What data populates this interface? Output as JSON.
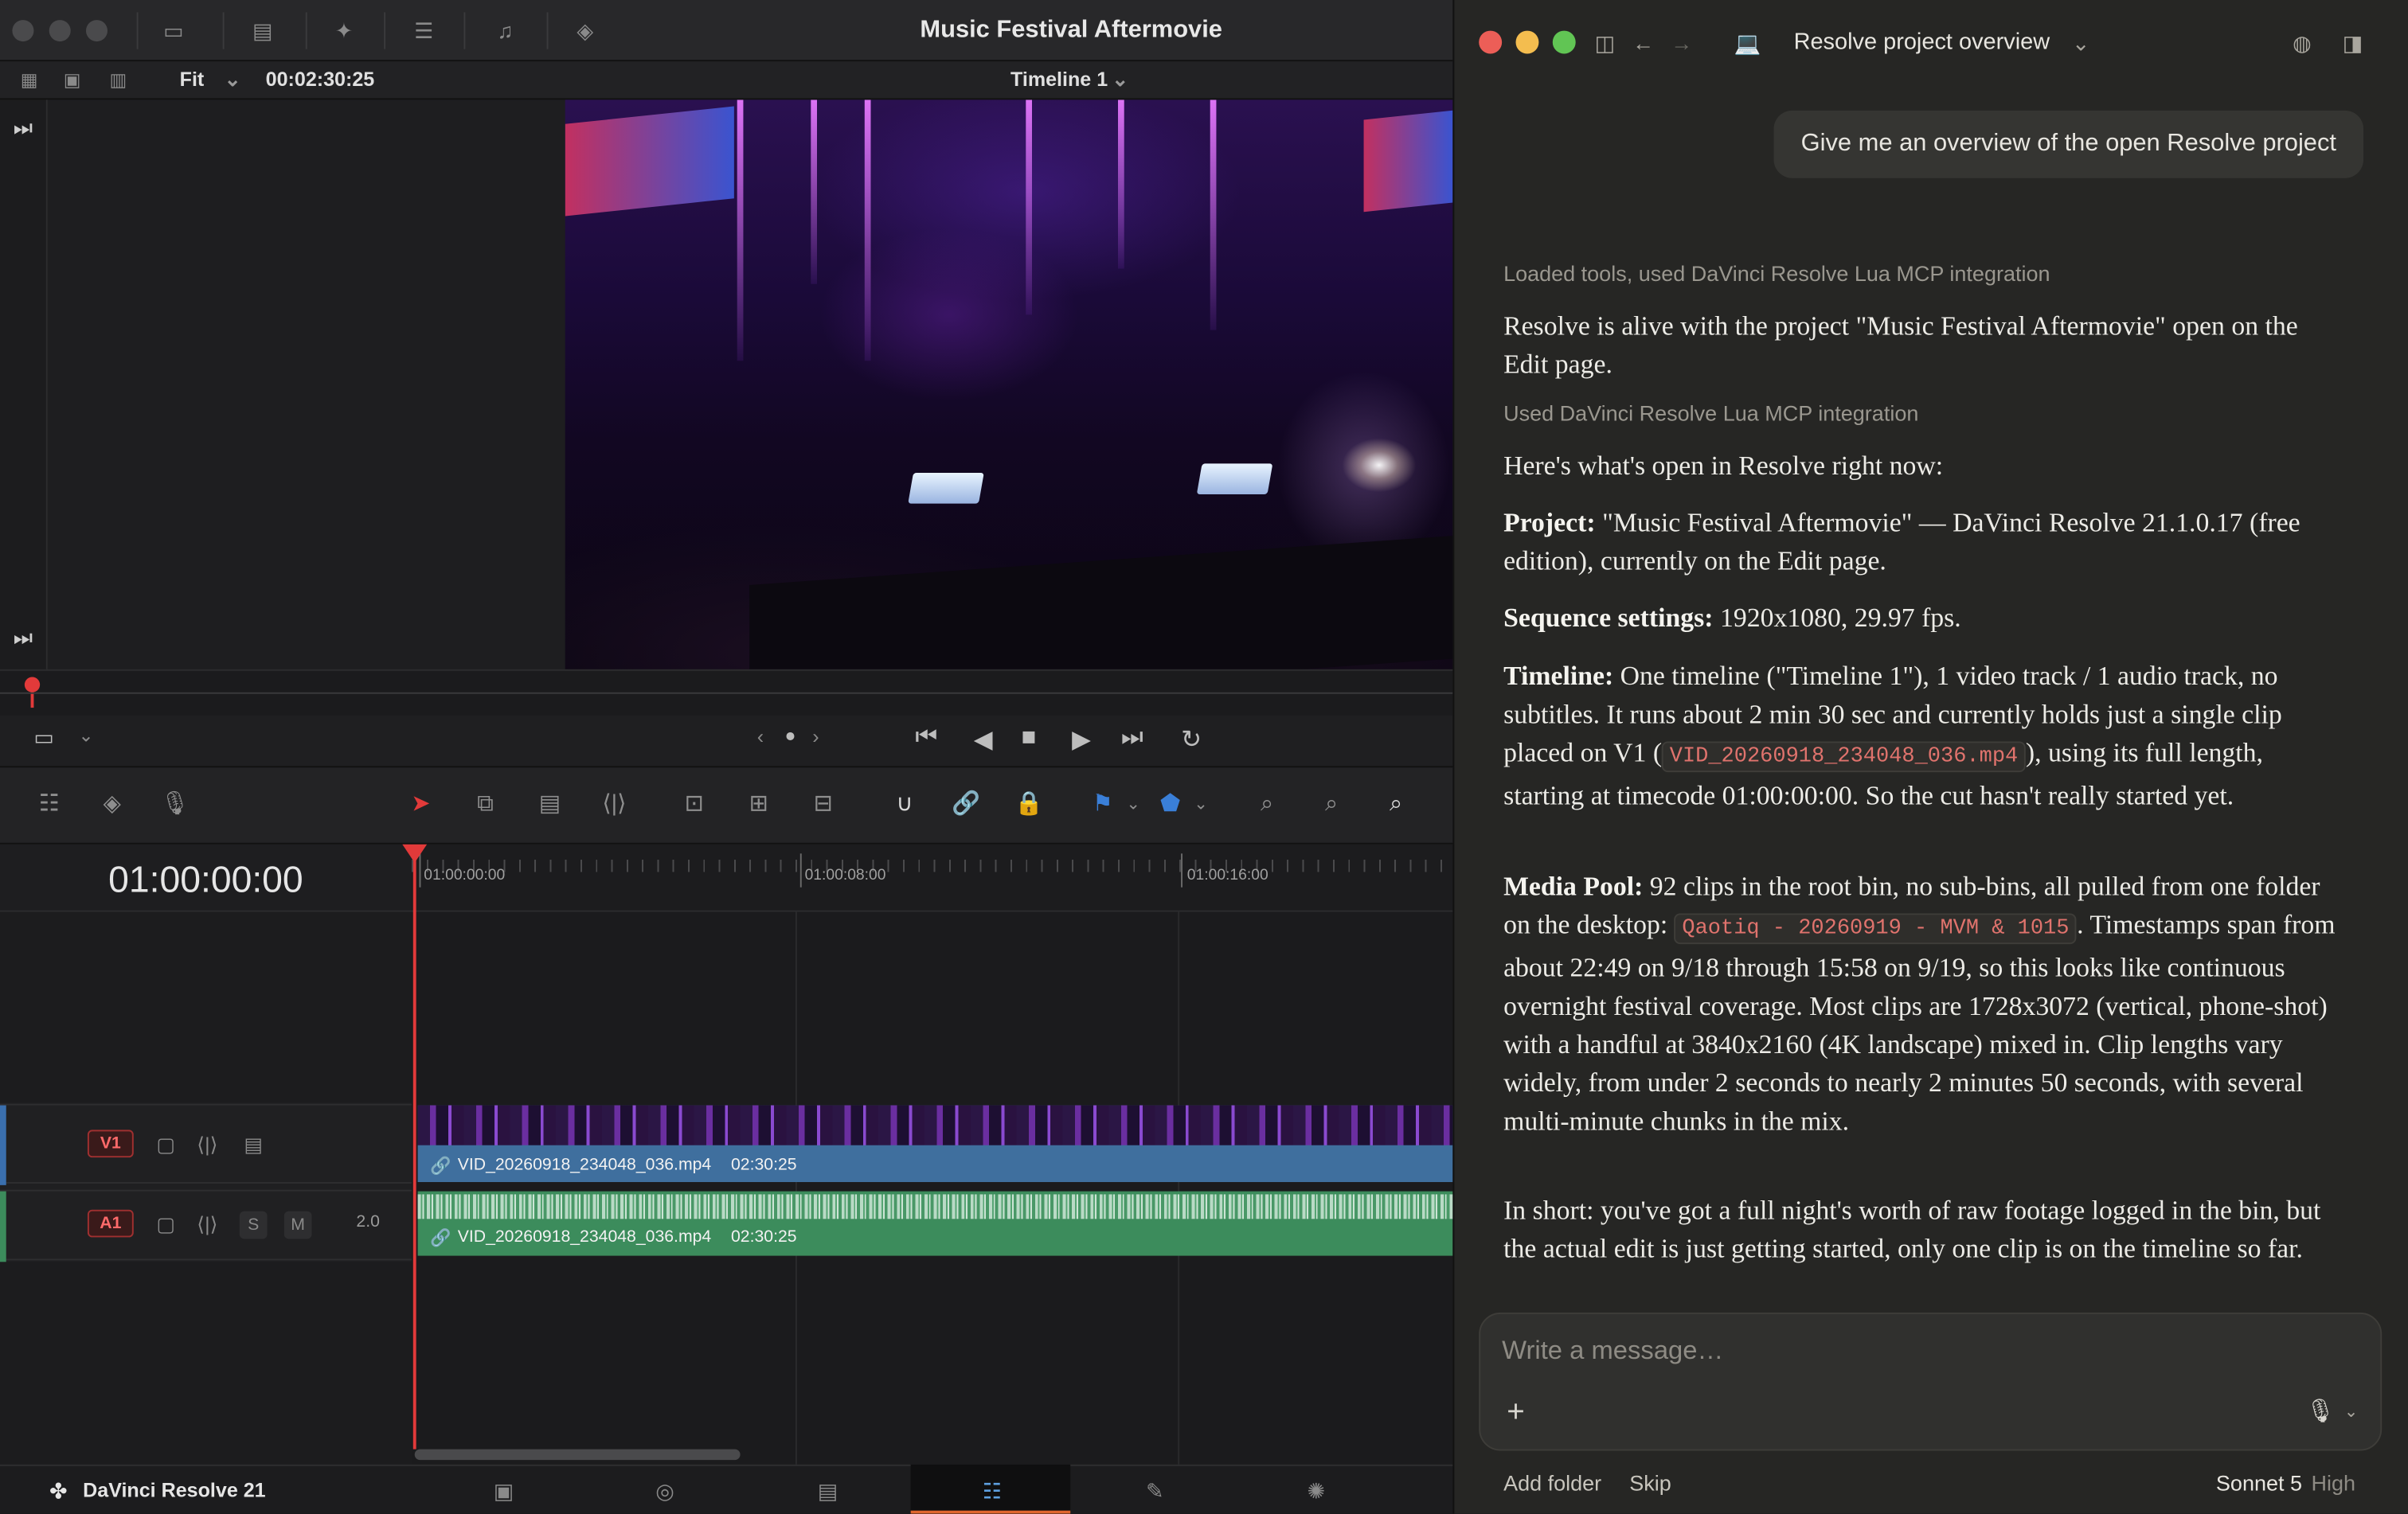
{
  "resolve": {
    "title": "Music Festival Aftermovie",
    "viewer": {
      "zoom": "Fit",
      "timecode": "00:02:30:25",
      "timeline_name": "Timeline 1"
    },
    "timeline": {
      "timecode": "01:00:00:00",
      "ruler_labels": [
        "01:00:00:00",
        "01:00:08:00",
        "01:00:16:00"
      ],
      "tracks": [
        {
          "id": "V1",
          "clip_name": "VID_20260918_234048_036.mp4",
          "clip_duration": "02:30:25"
        },
        {
          "id": "A1",
          "clip_name": "VID_20260918_234048_036.mp4",
          "clip_duration": "02:30:25",
          "channels": "2.0",
          "solo": "S",
          "mute": "M"
        }
      ]
    },
    "brand": "DaVinci Resolve 21",
    "accent_color": "#e0662e",
    "playhead_color": "#e23a3a"
  },
  "claude": {
    "conversation_title": "Resolve project overview",
    "user_message": "Give me an overview of the open Resolve project",
    "meta1": "Loaded tools, used DaVinci Resolve Lua MCP integration",
    "p1": "Resolve is alive with the project \"Music Festival Aftermovie\" open on the Edit page.",
    "meta2": "Used DaVinci Resolve Lua MCP integration",
    "p2": "Here's what's open in Resolve right now:",
    "project_label": "Project:",
    "project_text": " \"Music Festival Aftermovie\" — DaVinci Resolve 21.1.0.17 (free edition), currently on the Edit page.",
    "seq_label": "Sequence settings:",
    "seq_text": " 1920x1080, 29.97 fps.",
    "timeline_label": "Timeline:",
    "timeline_text_a": " One timeline (\"Timeline 1\"), 1 video track / 1 audio track, no subtitles. It runs about 2 min 30 sec and currently holds just a single clip placed on V1 (",
    "timeline_code": "VID_20260918_234048_036.mp4",
    "timeline_text_b": "), using its full length, starting at timecode 01:00:00:00. So the cut hasn't really started yet.",
    "pool_label": "Media Pool:",
    "pool_text_a": " 92 clips in the root bin, no sub-bins, all pulled from one folder on the desktop: ",
    "pool_code": "Qaotiq - 20260919 - MVM & 1015",
    "pool_text_b": ". Timestamps span from about 22:49 on 9/18 through 15:58 on 9/19, so this looks like continuous overnight festival coverage. Most clips are 1728x3072 (vertical, phone-shot) with a handful at 3840x2160 (4K landscape) mixed in. Clip lengths vary widely, from under 2 seconds to nearly 2 minutes 50 seconds, with several multi-minute chunks in the mix.",
    "summary": "In short: you've got a full night's worth of raw footage logged in the bin, but the actual edit is just getting started, only one clip is on the timeline so far.",
    "composer_placeholder": "Write a message…",
    "add_folder": "Add folder",
    "skip": "Skip",
    "model": "Sonnet 5",
    "effort": "High",
    "code_color": "#e0736d"
  }
}
